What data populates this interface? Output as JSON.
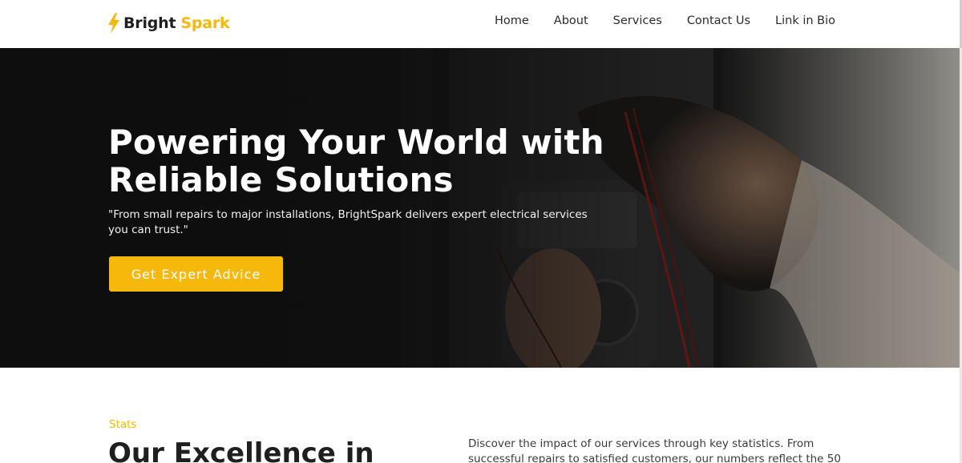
{
  "header": {
    "logo": {
      "part1": "Bright",
      "part2": "Spark"
    },
    "nav": [
      {
        "label": "Home"
      },
      {
        "label": "About"
      },
      {
        "label": "Services"
      },
      {
        "label": "Contact Us"
      },
      {
        "label": "Link in Bio"
      }
    ]
  },
  "hero": {
    "title": "Powering Your World with Reliable Solutions",
    "subtitle": "\"From small repairs to major installations, BrightSpark delivers expert electrical services you can trust.\"",
    "cta_label": "Get Expert Advice",
    "image_icon": "electrician-multimeter-photo"
  },
  "stats": {
    "label": "Stats",
    "heading": "Our Excellence in",
    "description": "Discover the impact of our services through key statistics. From successful repairs to satisfied customers, our numbers reflect the 50"
  },
  "colors": {
    "accent": "#f5b80b",
    "hero_bg": "#141414",
    "text_dark": "#1f1f1f"
  }
}
